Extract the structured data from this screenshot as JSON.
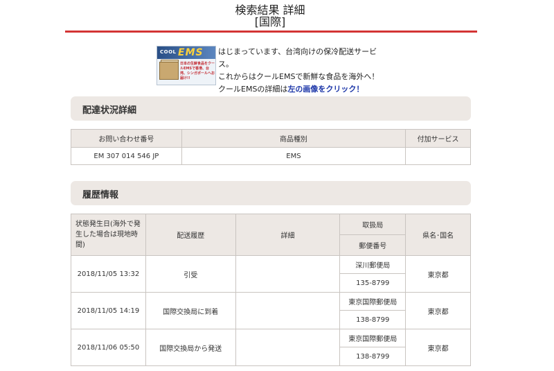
{
  "page": {
    "title_line1": "検索結果 詳細",
    "title_line2": "[国際]"
  },
  "banner": {
    "logo_cool": "COOL",
    "logo_ems": "EMS",
    "image_small_text": "日本の生鮮食品をクールEMSで香港、台湾、シンガポールへお届け!!",
    "line1": "はじまっています、台湾向けの保冷配送サービス。",
    "line2": "これからはクールEMSで新鮮な食品を海外へ！",
    "line3_prefix": "クールEMSの詳細は",
    "line3_link": "左の画像をクリック！"
  },
  "delivery_section": {
    "title": "配達状況詳細",
    "headers": [
      "お問い合わせ番号",
      "商品種別",
      "付加サービス"
    ],
    "row": {
      "tracking_number": "EM 307 014 546 JP",
      "product_type": "EMS",
      "additional_service": ""
    }
  },
  "history_section": {
    "title": "履歴情報",
    "headers": {
      "date": "状態発生日(海外で発生した場合は現地時間)",
      "history": "配送履歴",
      "details": "詳細",
      "office": "取扱局",
      "postal_code": "郵便番号",
      "region": "県名･国名"
    },
    "rows": [
      {
        "date": "2018/11/05 13:32",
        "status": "引受",
        "details": "",
        "office": "深川郵便局",
        "postal_code": "135-8799",
        "region": "東京都"
      },
      {
        "date": "2018/11/05 14:19",
        "status": "国際交換局に到着",
        "details": "",
        "office": "東京国際郵便局",
        "postal_code": "138-8799",
        "region": "東京都"
      },
      {
        "date": "2018/11/06 05:50",
        "status": "国際交換局から発送",
        "details": "",
        "office": "東京国際郵便局",
        "postal_code": "138-8799",
        "region": "東京都"
      }
    ]
  },
  "colors": {
    "title_rule": "#d33434",
    "section_bg": "#ede8e4",
    "border": "#c9c4c0",
    "cta_link": "#1c36a8"
  }
}
